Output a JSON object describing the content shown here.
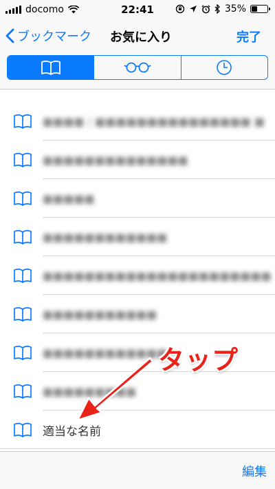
{
  "status_bar": {
    "carrier": "docomo",
    "time": "22:41",
    "battery": "35%",
    "battery_level": 0.35
  },
  "nav": {
    "back_label": "ブックマーク",
    "title": "お気に入り",
    "done_label": "完了"
  },
  "segments": [
    {
      "icon": "book-icon",
      "active": true
    },
    {
      "icon": "glasses-icon",
      "active": false
    },
    {
      "icon": "clock-icon",
      "active": false
    }
  ],
  "bookmarks": [
    {
      "label": "■■■■ | ■■■■■■■■■■■■■■■ ■",
      "obscured": true
    },
    {
      "label": "■■■■■■■■■■■■■■",
      "obscured": true
    },
    {
      "label": "■■■■■",
      "obscured": true
    },
    {
      "label": "■■■■■■■■■■■■",
      "obscured": true
    },
    {
      "label": "■■■■■■■■■■■■■■■■■■■■■■",
      "obscured": true
    },
    {
      "label": "■■■■■■■■■■■",
      "obscured": true
    },
    {
      "label": "■■■■■■■■■■■■",
      "obscured": true
    },
    {
      "label": "■■■■■■■■■",
      "obscured": true
    },
    {
      "label": "適当な名前",
      "obscured": false
    }
  ],
  "toolbar": {
    "edit_label": "編集"
  },
  "annotation": {
    "text": "タップ",
    "color": "#e8231a"
  },
  "colors": {
    "accent": "#0a7aff",
    "bar_background": "#f8f8f8"
  }
}
